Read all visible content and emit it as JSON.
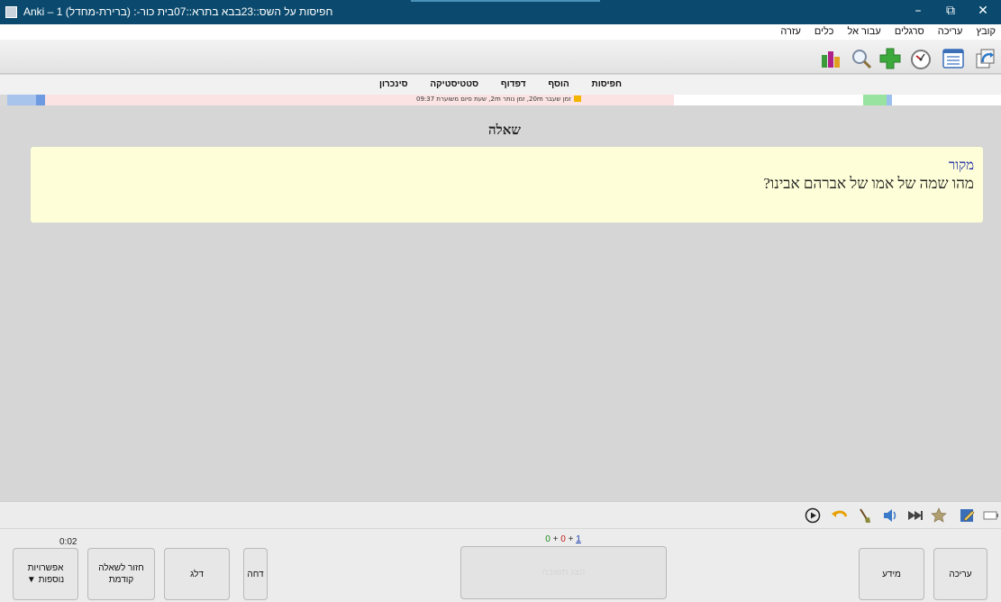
{
  "window": {
    "title": "Anki – חפיסות על השס::23בבא בתרא::07בית כור-: (ברירת-מחדל) 1",
    "minimize_glyph": "–",
    "restore_glyph": "⧉",
    "close_glyph": "✕"
  },
  "menu": {
    "items": [
      "קובץ",
      "עריכה",
      "סרגלים",
      "עבור אל",
      "כלים",
      "עזרה"
    ]
  },
  "toolbar": {
    "icons": [
      "sync-icon",
      "deck-list-icon",
      "timer-icon",
      "add-icon",
      "search-icon",
      "stats-icon"
    ]
  },
  "nav": {
    "items": [
      "חפיסות",
      "הוסף",
      "דפדוף",
      "סטטיסטיקה",
      "סינכרון"
    ]
  },
  "progress": {
    "info_text": "זמן שעבר 20m, זמן נותר 2m, שעת סיום משוערת 09:37"
  },
  "card": {
    "heading": "שאלה",
    "source_label": "מקור",
    "question": "מהו שמה של אמו של אברהם אבינו?"
  },
  "reviewer": {
    "timer": "0:02",
    "count_new": "0",
    "count_learn": "0",
    "count_review": "1",
    "count_sep": "+",
    "buttons": {
      "edit": "עריכה",
      "info": "מידע",
      "show_answer": "הצג תשובה",
      "bury": "דחה",
      "skip": "דלג",
      "back_line1": "חזור לשאלה",
      "back_line2": "קודמת",
      "more_line1": "אפשרויות",
      "more_line2": "נוספות ▼"
    }
  },
  "colors": {
    "titlebar": "#0b4a6e",
    "card_background": "#fefed8",
    "source_text": "#1d2aa8",
    "new_count": "#1c8a1c",
    "learn_count": "#c01919",
    "review_count": "#1238b0"
  }
}
